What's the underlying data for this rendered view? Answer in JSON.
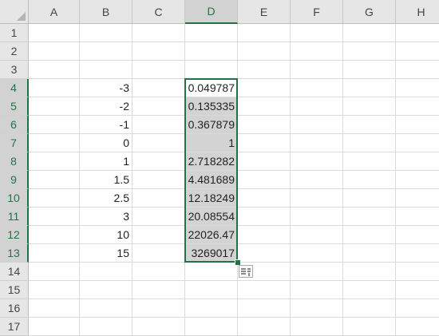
{
  "sheet": {
    "columns": [
      "A",
      "B",
      "C",
      "D",
      "E",
      "F",
      "G",
      "H"
    ],
    "rows": [
      "1",
      "2",
      "3",
      "4",
      "5",
      "6",
      "7",
      "8",
      "9",
      "10",
      "11",
      "12",
      "13",
      "14",
      "15",
      "16",
      "17"
    ],
    "selected_column": "D",
    "selected_rows": [
      "4",
      "5",
      "6",
      "7",
      "8",
      "9",
      "10",
      "11",
      "12",
      "13"
    ],
    "column_b_values": [
      "-3",
      "-2",
      "-1",
      "0",
      "1",
      "1.5",
      "2.5",
      "3",
      "10",
      "15"
    ],
    "column_d_values": [
      "0.049787",
      "0.135335",
      "0.367879",
      "1",
      "2.718282",
      "4.481689",
      "12.18249",
      "20.08554",
      "22026.47",
      "3269017"
    ],
    "data_start_row": 4,
    "accent_color": "#217346",
    "selection_fill": "#d3d3d3",
    "quick_analysis_icon": "quick-analysis-icon"
  }
}
